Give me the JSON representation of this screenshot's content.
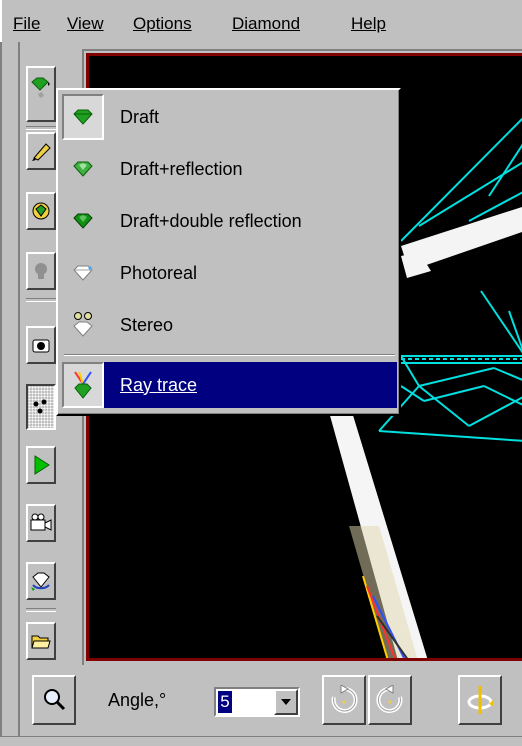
{
  "menubar": {
    "file": "File",
    "view": "View",
    "options": "Options",
    "diamond": "Diamond",
    "help": "Help"
  },
  "popup": {
    "items": [
      {
        "label": "Draft",
        "icon": "draft-diamond-icon",
        "checked": true
      },
      {
        "label": "Draft+reflection",
        "icon": "draft-reflection-diamond-icon"
      },
      {
        "label": "Draft+double reflection",
        "icon": "draft-double-reflection-diamond-icon"
      },
      {
        "label": "Photoreal",
        "icon": "photoreal-diamond-icon"
      },
      {
        "label": "Stereo",
        "icon": "stereo-diamond-icon"
      },
      {
        "label": "Ray trace",
        "icon": "ray-trace-icon",
        "selected": true
      }
    ]
  },
  "bottombar": {
    "angle_label": "Angle,°",
    "angle_value": "5"
  },
  "colors": {
    "viewport_bg": "#000000",
    "viewport_border": "#800000",
    "wireframe": "#00e0e0",
    "menu_highlight": "#000080",
    "diamond_green": "#20a020"
  }
}
